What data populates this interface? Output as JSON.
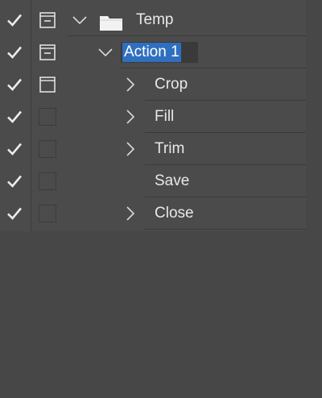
{
  "rows": [
    {
      "label": "Temp",
      "kind": "set",
      "enabled": true,
      "dialog": "partial",
      "expanded": true
    },
    {
      "label": "Action 1",
      "kind": "action",
      "enabled": true,
      "dialog": "partial",
      "expanded": true,
      "editing": true
    },
    {
      "label": "Crop",
      "kind": "step",
      "enabled": true,
      "dialog": "on",
      "expandable": true
    },
    {
      "label": "Fill",
      "kind": "step",
      "enabled": true,
      "dialog": "off",
      "expandable": true
    },
    {
      "label": "Trim",
      "kind": "step",
      "enabled": true,
      "dialog": "off",
      "expandable": true
    },
    {
      "label": "Save",
      "kind": "step",
      "enabled": true,
      "dialog": "off",
      "expandable": false
    },
    {
      "label": "Close",
      "kind": "step",
      "enabled": true,
      "dialog": "off",
      "expandable": true
    }
  ],
  "icons": {
    "check": "checkmark-icon",
    "dialog": "dialog-toggle-icon",
    "folder": "folder-icon",
    "chevron_down": "chevron-down-icon",
    "chevron_right": "chevron-right-icon"
  },
  "colors": {
    "panel_bg": "#474747",
    "list_bg": "#4b4b4b",
    "text": "#e8e8e8",
    "selection": "#2f6fbf"
  }
}
